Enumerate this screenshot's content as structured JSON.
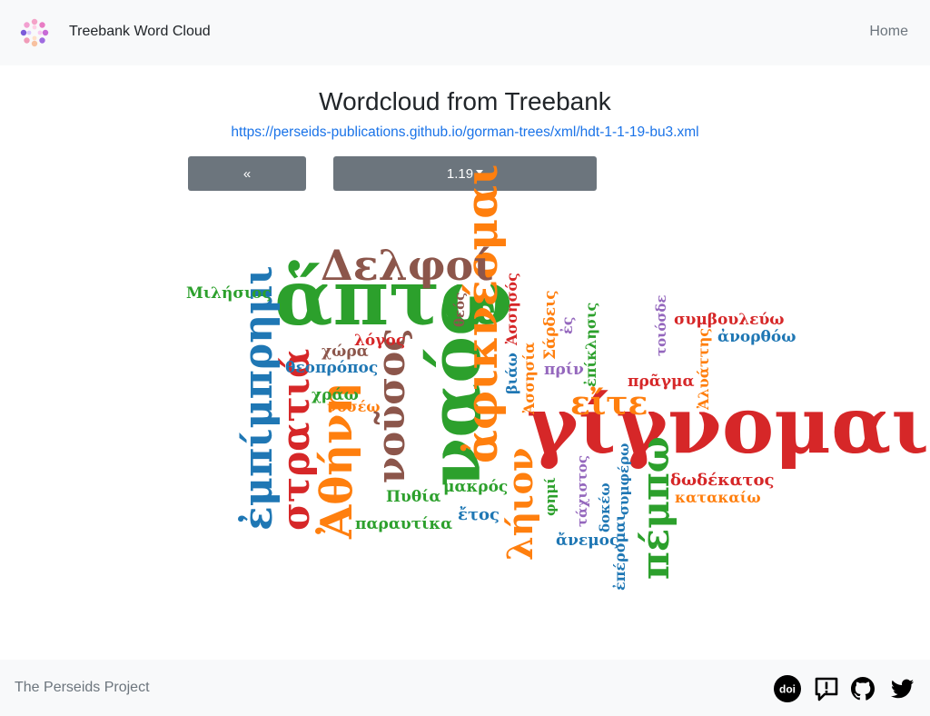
{
  "navbar": {
    "brand": "Treebank Word Cloud",
    "home": "Home"
  },
  "page": {
    "title": "Wordcloud from Treebank",
    "source_url": "https://perseids-publications.github.io/gorman-trees/xml/hdt-1-1-19-bu3.xml"
  },
  "controls": {
    "prev_label": "«",
    "section_label": "1.19"
  },
  "wordcloud": {
    "colors": {
      "blue": "#1f77b4",
      "orange": "#ff7f0e",
      "green": "#2ca02c",
      "red": "#d62728",
      "purple": "#9467bd",
      "brown": "#8c564b"
    },
    "words": [
      "ἅπτω",
      "γίγνομαι",
      "ναός",
      "ἀφικνέομαι",
      "Δελφοί",
      "νοῦσος",
      "Ἀθήνη",
      "στρατιά",
      "ἐμπίμπρημι",
      "πέμπω",
      "λήιον",
      "εἴτε",
      "Μιλήσιος",
      "θεός",
      "Ἀσσησός",
      "Σάρδεις",
      "ἐς",
      "ἐπίκλησις",
      "τοιόσδε",
      "Ἀλυάττης",
      "συμβουλεύω",
      "ἀνορθόω",
      "λόγος",
      "χώρα",
      "θεοπρόπος",
      "βιάω",
      "Ἀσσησία",
      "πρίν",
      "πρᾶγμα",
      "χράω",
      "νοσέω",
      "δωδέκατος",
      "κατακαίω",
      "Πυθία",
      "μακρός",
      "φημί",
      "τάχιστος",
      "συμφέρω",
      "δοκέω",
      "ἔτος",
      "παραυτίκα",
      "ἄνεμος",
      "ἐπέρομαι"
    ]
  },
  "footer": {
    "text": "The Perseids Project"
  },
  "icons": [
    "logo-icon",
    "doi-icon",
    "report-issue-icon",
    "github-icon",
    "twitter-icon"
  ]
}
